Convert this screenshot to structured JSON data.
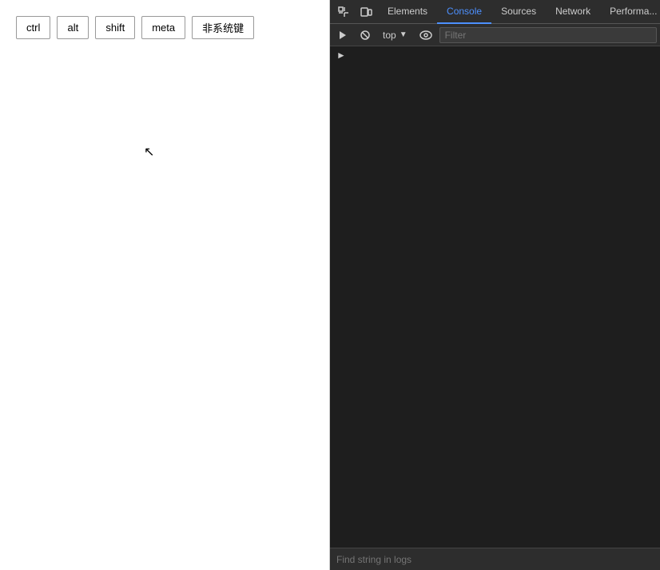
{
  "left_panel": {
    "buttons": [
      {
        "id": "ctrl",
        "label": "ctrl"
      },
      {
        "id": "alt",
        "label": "alt"
      },
      {
        "id": "shift",
        "label": "shift"
      },
      {
        "id": "meta",
        "label": "meta"
      },
      {
        "id": "non-system",
        "label": "非系统键"
      }
    ]
  },
  "devtools": {
    "tabs": [
      {
        "id": "elements",
        "label": "Elements",
        "active": false
      },
      {
        "id": "console",
        "label": "Console",
        "active": true
      },
      {
        "id": "sources",
        "label": "Sources",
        "active": false
      },
      {
        "id": "network",
        "label": "Network",
        "active": false
      },
      {
        "id": "performance",
        "label": "Performa...",
        "active": false
      }
    ],
    "console": {
      "top_dropdown_label": "top",
      "filter_placeholder": "Filter",
      "find_logs_placeholder": "Find string in logs"
    }
  }
}
